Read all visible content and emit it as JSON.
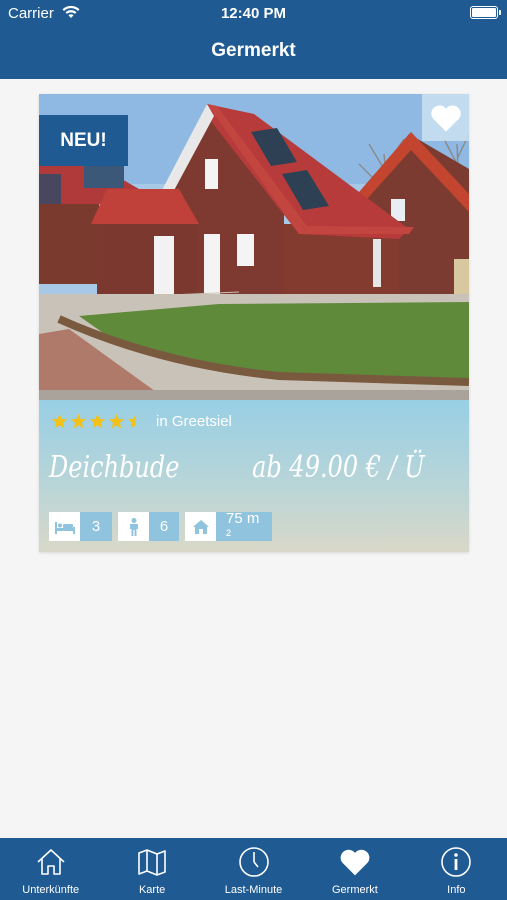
{
  "status_bar": {
    "carrier": "Carrier",
    "time": "12:40 PM"
  },
  "nav": {
    "title": "Germerkt"
  },
  "listing": {
    "badge": "NEU!",
    "rating_stars": 4.5,
    "location": "in Greetsiel",
    "name": "Deichbude",
    "price": "ab 49.00 € / Ü",
    "features": [
      {
        "icon": "bed-icon",
        "value": "3"
      },
      {
        "icon": "person-icon",
        "value": "6"
      },
      {
        "icon": "house-icon",
        "value": "75 m ²"
      }
    ]
  },
  "tabs": [
    {
      "icon": "house-outline-icon",
      "label": "Unterkünfte"
    },
    {
      "icon": "map-icon",
      "label": "Karte"
    },
    {
      "icon": "clock-icon",
      "label": "Last-Minute"
    },
    {
      "icon": "heart-icon",
      "label": "Germerkt"
    },
    {
      "icon": "info-icon",
      "label": "Info"
    }
  ],
  "colors": {
    "primary": "#1f5a92",
    "star": "#f2c21a",
    "feature_value_bg": "#8fc3de"
  }
}
